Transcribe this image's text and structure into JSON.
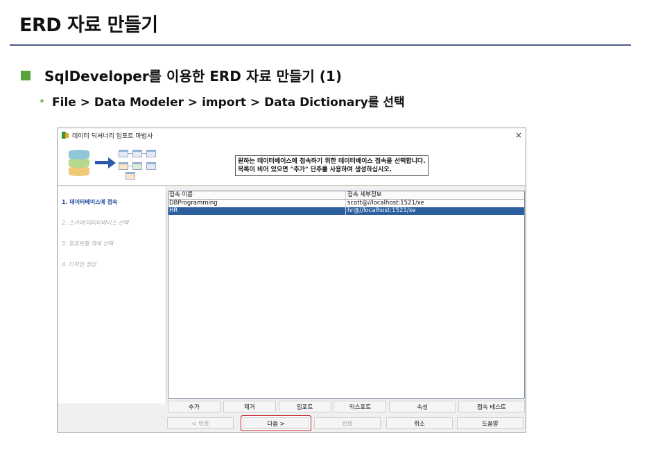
{
  "slide": {
    "title": "ERD 자료 만들기",
    "bullet_main": "SqlDeveloper를 이용한 ERD 자료 만들기 (1)",
    "bullet_sub": "File > Data Modeler > import > Data Dictionary를 선택"
  },
  "dialog": {
    "title": "데이터 딕셔너리 임포트 마법사",
    "close": "×",
    "instruction_line1": "원하는 데이터베이스에 접속하기 위한 데이터베이스 접속을 선택합니다.",
    "instruction_line2": "목록이 비어 있으면 \"추가\" 단추를 사용하여 생성하십시오.",
    "steps": [
      {
        "label": "1. 데이터베이스에 접속",
        "active": true
      },
      {
        "label": "2. 스키마/데이터베이스 선택",
        "active": false
      },
      {
        "label": "3. 임포트할 객체 선택",
        "active": false
      },
      {
        "label": "4. 디자인 생성",
        "active": false
      }
    ],
    "table": {
      "headers": [
        "접속 이름",
        "접속 세부정보"
      ],
      "rows": [
        {
          "name": "DBProgramming",
          "details": "scott@//localhost:1521/xe",
          "selected": false
        },
        {
          "name": "HR",
          "details": "hr@//localhost:1521/xe",
          "selected": true
        }
      ]
    },
    "conn_buttons": {
      "add": "추가",
      "remove": "제거",
      "import": "임포트",
      "export": "익스포트",
      "properties": "속성",
      "test": "접속 테스트"
    },
    "nav_buttons": {
      "back": "< 뒤로",
      "next": "다음 >",
      "finish": "완료",
      "cancel": "취소",
      "help": "도움말"
    }
  },
  "colors": {
    "accent_square": "#57a33d",
    "selected_row": "#2c5f9e",
    "highlight_box": "#c1272d",
    "active_step": "#1f4aa0"
  }
}
